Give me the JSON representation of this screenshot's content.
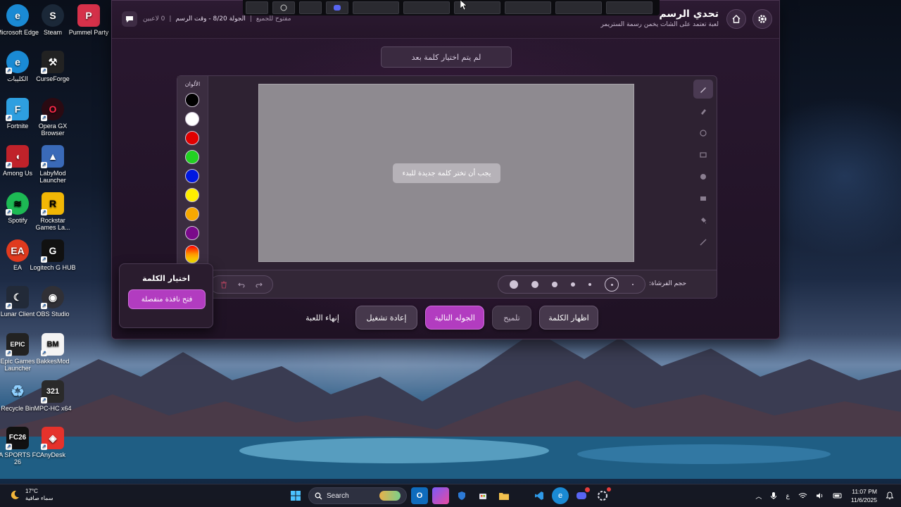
{
  "desktop_icons": [
    {
      "label": "Microsoft Edge",
      "glyph": "edge-icon",
      "color": "#1a8ad4"
    },
    {
      "label": "Steam",
      "glyph": "steam-icon",
      "color": "#1b2838"
    },
    {
      "label": "Pummel Party",
      "glyph": "pummel-icon",
      "color": "#d6314a"
    },
    {
      "label": "الكليبات",
      "glyph": "edge-icon",
      "color": "#1a8ad4"
    },
    {
      "label": "CurseForge",
      "glyph": "curseforge-icon",
      "color": "#222222"
    },
    {
      "label": "Fortnite",
      "glyph": "fortnite-icon",
      "color": "#2e9fe0"
    },
    {
      "label": "Opera GX Browser",
      "glyph": "opera-icon",
      "color": "#2a0a12"
    },
    {
      "label": "Among Us",
      "glyph": "amongus-icon",
      "color": "#c0222a"
    },
    {
      "label": "LabyMod Launcher",
      "glyph": "labymod-icon",
      "color": "#3a6ab8"
    },
    {
      "label": "Spotify",
      "glyph": "spotify-icon",
      "color": "#1db954"
    },
    {
      "label": "Rockstar Games La...",
      "glyph": "rockstar-icon",
      "color": "#f2b705"
    },
    {
      "label": "EA",
      "glyph": "ea-icon",
      "color": "#e03a1e"
    },
    {
      "label": "Logitech G HUB",
      "glyph": "logitech-icon",
      "color": "#111111"
    },
    {
      "label": "Lunar Client",
      "glyph": "lunar-icon",
      "color": "#222a38"
    },
    {
      "label": "OBS Studio",
      "glyph": "obs-icon",
      "color": "#303036"
    },
    {
      "label": "Epic Games Launcher",
      "glyph": "epic-icon",
      "color": "#222222"
    },
    {
      "label": "BakkesMod",
      "glyph": "bakkesmod-icon",
      "color": "#f4f4f4"
    },
    {
      "label": "Recycle Bin",
      "glyph": "recycle-icon",
      "color": "#3a90d0"
    },
    {
      "label": "MPC-HC x64",
      "glyph": "mpc-icon",
      "color": "#2a2a2a"
    },
    {
      "label": "EA SPORTS FC 26",
      "glyph": "fc26-icon",
      "color": "#111111"
    },
    {
      "label": "AnyDesk",
      "glyph": "anydesk-icon",
      "color": "#e5322b"
    }
  ],
  "app": {
    "title": "تحدي الرسم",
    "subtitle": "لعبة تعتمد على الشات يخمن رسمة الستريمر",
    "round_label": "الجولة 8/20 - وقت الرسم",
    "mode_label": "مفتوح للجميع",
    "players_label": "0 لاعبين",
    "word_status": "لم يتم اختيار كلمة بعد",
    "canvas_message": "يجب أن تختر كلمة جديدة للبدء",
    "palette_title": "الألوان",
    "brush_size_label": "حجم الفرشاة:",
    "colors": [
      "#000000",
      "#ffffff",
      "#e00000",
      "#22d022",
      "#0018e0",
      "#ffee00",
      "#f6a800",
      "#7a0a8a"
    ],
    "tools": [
      "brush-icon",
      "eraser-icon",
      "circle-icon",
      "rectangle-icon",
      "filled-circle-icon",
      "filled-rectangle-icon",
      "fill-icon",
      "line-icon"
    ]
  },
  "actions": {
    "show_word": "اظهار الكلمة",
    "hint": "تلميح",
    "next_round": "الجوله التالية",
    "restart": "إعادة تشغيل",
    "end_game": "إنهاء اللعبة"
  },
  "chooser": {
    "title": "اختيار الكلمة",
    "open_window": "فتح نافذة منفصلة"
  },
  "taskbar": {
    "temperature": "17°C",
    "weather_desc": "سماء صافية",
    "search_placeholder": "Search",
    "lang": "ع",
    "time": "11:07 PM",
    "date": "11/6/2025"
  },
  "colors": {
    "accent": "#b23cc0",
    "panel": "#2a1830"
  }
}
